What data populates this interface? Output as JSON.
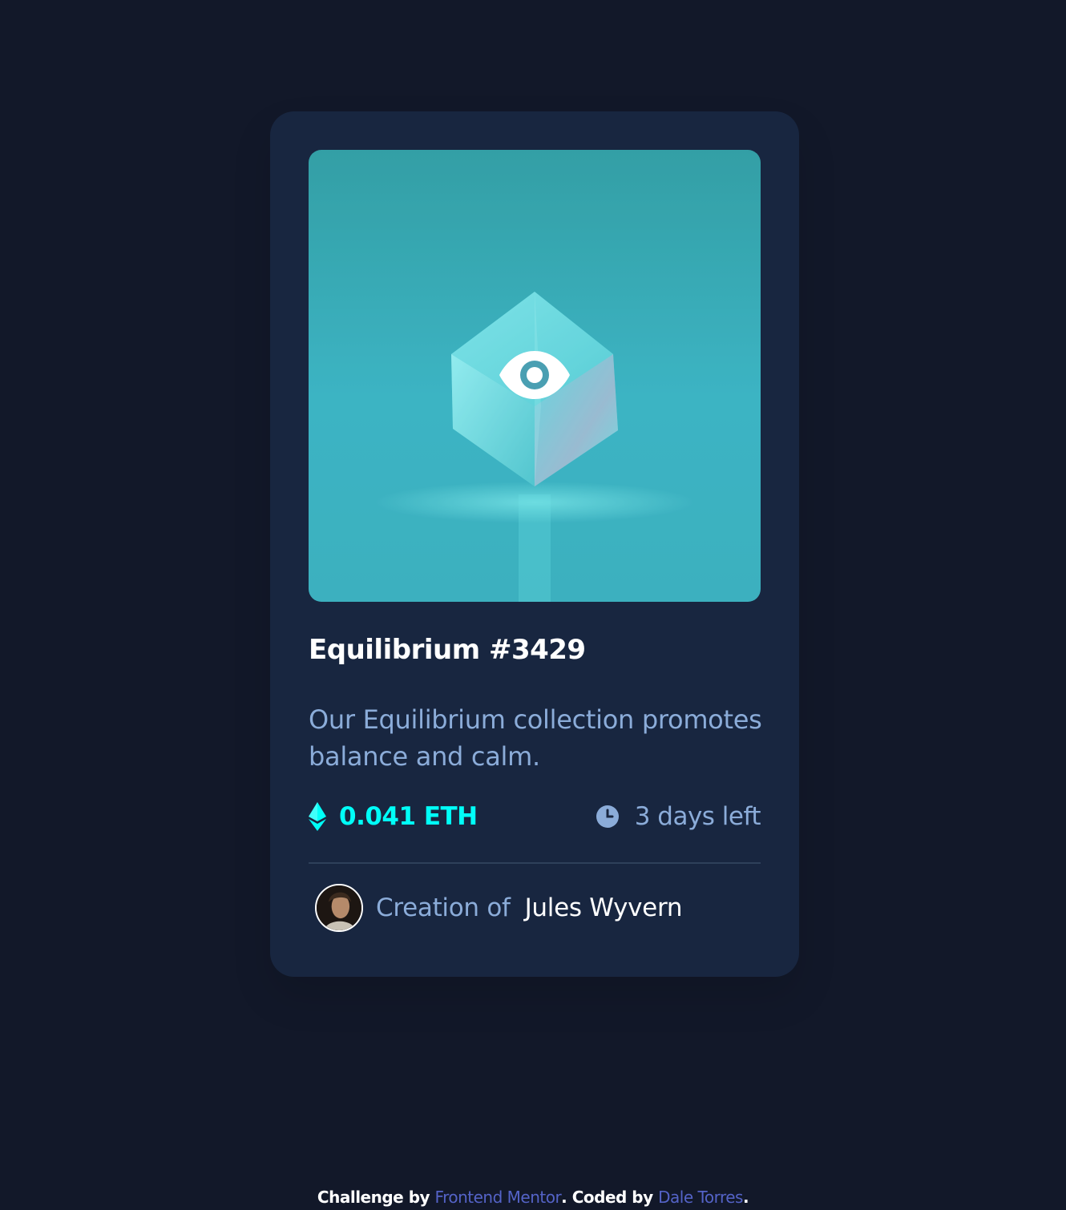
{
  "card": {
    "image_alt": "Equilibrium",
    "title": "Equilibrium #3429",
    "description": "Our Equilibrium collection promotes balance and calm.",
    "price": "0.041 ETH",
    "time_left": "3 days left",
    "creator_prefix": "Creation of",
    "creator_name": "Jules Wyvern"
  },
  "footer": {
    "challenge_by": "Challenge by ",
    "challenge_link": "Frontend Mentor",
    "coded_by": ". Coded by ",
    "coder_link": "Dale Torres",
    "end": "."
  },
  "icons": {
    "eth": "ethereum-icon",
    "clock": "clock-icon",
    "view": "eye-icon"
  },
  "colors": {
    "page_bg": "#121829",
    "card_bg": "#182640",
    "cyan": "#00fff8",
    "soft_blue": "#8bacd9",
    "white": "#ffffff",
    "link": "#5463c7"
  }
}
